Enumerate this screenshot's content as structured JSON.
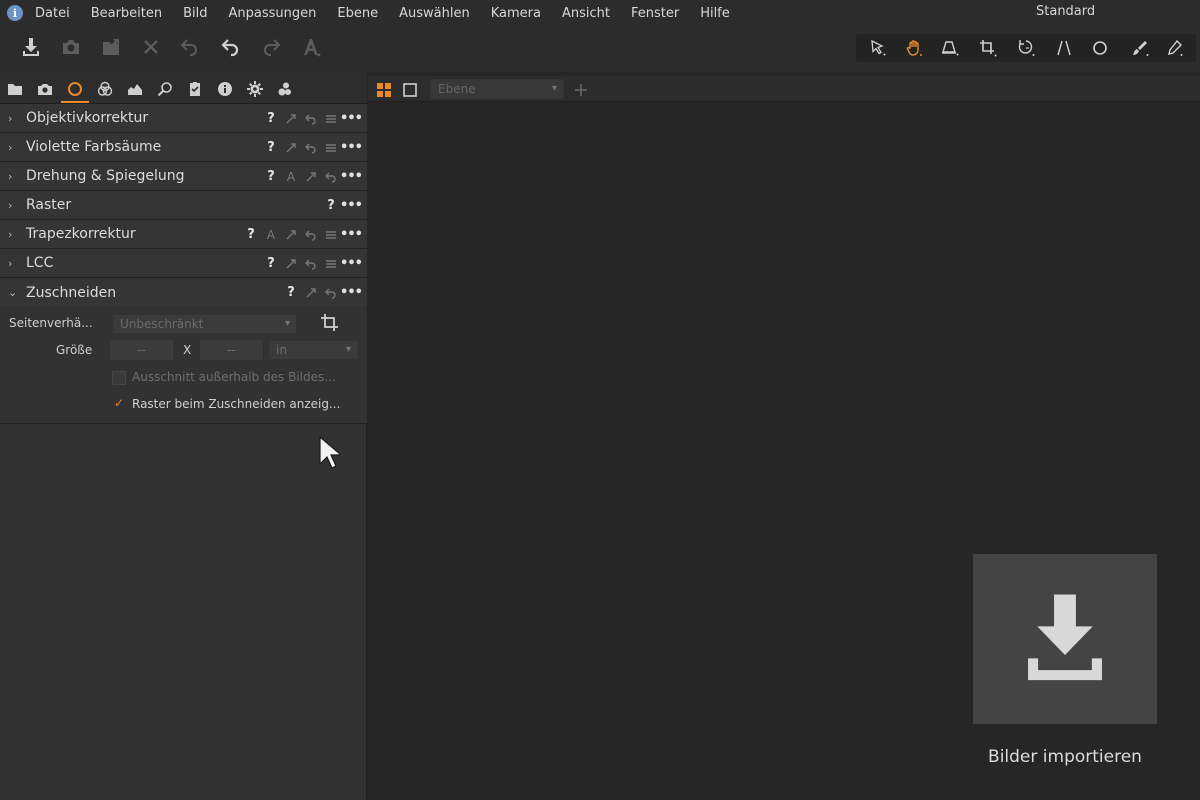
{
  "menubar": {
    "items": [
      "Datei",
      "Bearbeiten",
      "Bild",
      "Anpassungen",
      "Ebene",
      "Auswählen",
      "Kamera",
      "Ansicht",
      "Fenster",
      "Hilfe"
    ],
    "workspace": "Standard"
  },
  "icons": {
    "app": "info-icon",
    "toolbar": [
      "import-icon",
      "camera-icon",
      "export-icon",
      "delete-icon",
      "undo-all-icon",
      "undo-icon",
      "redo-icon",
      "auto-adjust-icon"
    ],
    "cursor_tools": [
      "select-icon",
      "pan-icon",
      "loupe-icon",
      "crop-icon",
      "rotate-icon",
      "keystone-icon",
      "spot-icon",
      "brush-icon",
      "eraser-icon"
    ]
  },
  "colors": {
    "accent": "#e8892a",
    "background": "#262626",
    "panel": "#313131"
  },
  "viewer": {
    "layer_placeholder": "Ebene",
    "import_label": "Bilder importieren"
  },
  "tools": [
    {
      "title": "Objektivkorrektur"
    },
    {
      "title": "Violette Farbsäume"
    },
    {
      "title": "Drehung & Spiegelung"
    },
    {
      "title": "Raster"
    },
    {
      "title": "Trapezkorrektur"
    },
    {
      "title": "LCC"
    },
    {
      "title": "Zuschneiden"
    }
  ],
  "crop": {
    "aspect_label": "Seitenverhä...",
    "aspect_value": "Unbeschränkt",
    "size_label": "Größe",
    "width_value": "--",
    "times": "X",
    "height_value": "--",
    "unit_value": "in",
    "outside_label": "Ausschnitt außerhalb des Bildes...",
    "outside_checked": false,
    "grid_label": "Raster beim Zuschneiden anzeig...",
    "grid_checked": true
  },
  "glyphs": {
    "help": "?",
    "more": "•••",
    "auto": "A",
    "check": "✓",
    "collapsed": "›",
    "expanded": "⌄",
    "dropdown": "▾"
  }
}
